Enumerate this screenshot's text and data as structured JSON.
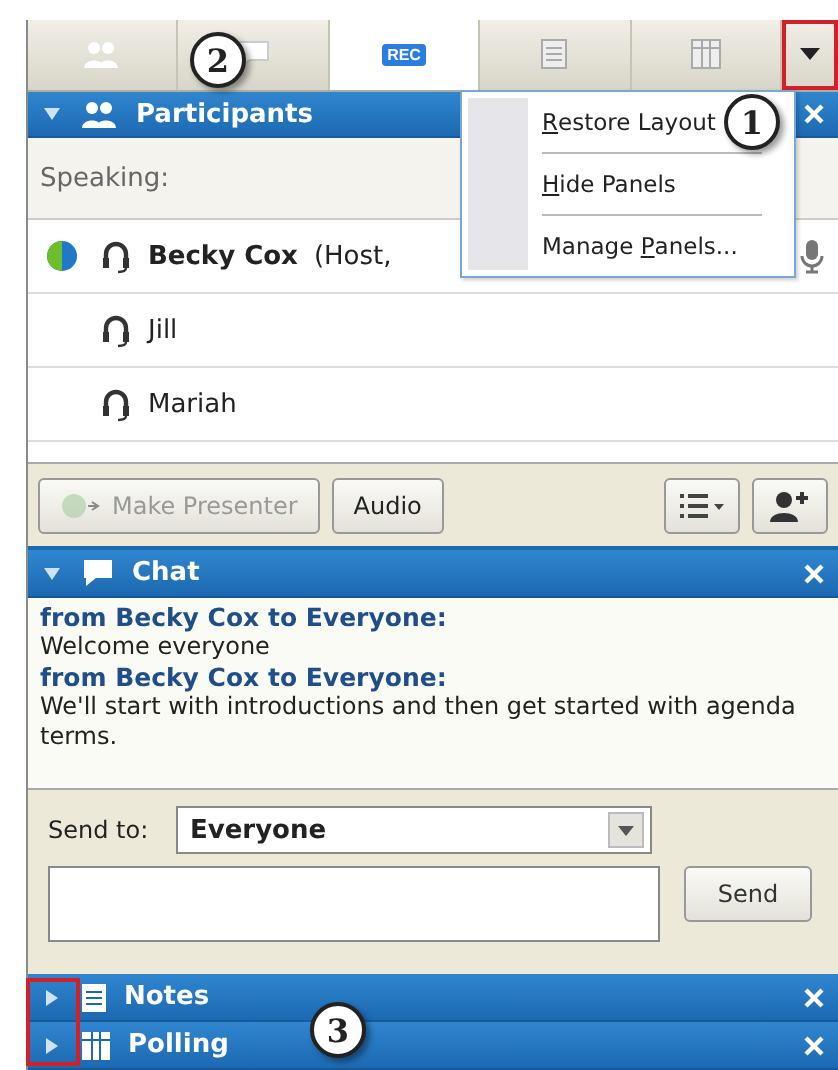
{
  "tabs": [
    {
      "kind": "people",
      "selected": false
    },
    {
      "kind": "chat",
      "selected": false
    },
    {
      "kind": "rec",
      "label": "REC",
      "selected": true
    },
    {
      "kind": "notes",
      "selected": false
    },
    {
      "kind": "polling",
      "selected": false
    }
  ],
  "menu_button": {
    "highlighted": true
  },
  "panels": [
    {
      "kind": "participants",
      "title": "Participants",
      "expanded": true
    },
    {
      "kind": "chat",
      "title": "Chat",
      "expanded": true
    },
    {
      "kind": "notes",
      "title": "Notes",
      "expanded": false
    },
    {
      "kind": "polling",
      "title": "Polling",
      "expanded": false
    }
  ],
  "participants": {
    "speaking_label": "Speaking:",
    "rows": [
      {
        "name": "Becky Cox",
        "detail": "(Host,",
        "presenter": true,
        "mic": true
      },
      {
        "name": "Jill",
        "presenter": false,
        "mic": false
      },
      {
        "name": "Mariah",
        "presenter": false,
        "mic": false
      }
    ],
    "buttons": [
      {
        "kind": "presenter",
        "label": "Make Presenter",
        "disabled": true
      },
      {
        "kind": "audio",
        "label": "Audio",
        "disabled": false
      }
    ]
  },
  "chat": {
    "messages": [
      {
        "from": "from Becky Cox to Everyone:",
        "text": "Welcome everyone"
      },
      {
        "from": "from Becky Cox to Everyone:",
        "text": "We'll start with introductions and then get started with agenda terms."
      }
    ],
    "send_to_label": "Send to:",
    "send_to_value": "Everyone",
    "send_button": "Send"
  },
  "menu": [
    {
      "key": "R",
      "after": "estore Layout"
    },
    {
      "key": "H",
      "after": "ide Panels"
    },
    {
      "before": "Manage ",
      "key": "P",
      "after": "anels..."
    }
  ],
  "callouts": [
    {
      "number": "1"
    },
    {
      "number": "2"
    },
    {
      "number": "3"
    }
  ]
}
